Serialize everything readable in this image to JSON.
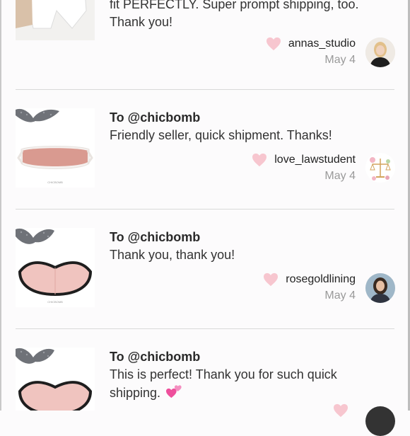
{
  "reviews": [
    {
      "to": "",
      "message": "fit PERFECTLY. Super prompt shipping, too. Thank you!",
      "username": "annas_studio",
      "date": "May 4"
    },
    {
      "to": "To @chicbomb",
      "message": "Friendly seller, quick shipment. Thanks!",
      "username": "love_lawstudent",
      "date": "May 4"
    },
    {
      "to": "To @chicbomb",
      "message": "Thank you, thank you!",
      "username": "rosegoldlining",
      "date": "May 4"
    },
    {
      "to": "To @chicbomb",
      "message": "This is perfect! Thank you for such quick shipping.",
      "username": "",
      "date": ""
    }
  ],
  "colors": {
    "heart": "#f7c6cf",
    "divider": "#d9d9d9",
    "mask_pink": "#f0c4bf"
  },
  "icons": {
    "heart": "heart-icon",
    "emoji": "two-hearts-emoji"
  }
}
